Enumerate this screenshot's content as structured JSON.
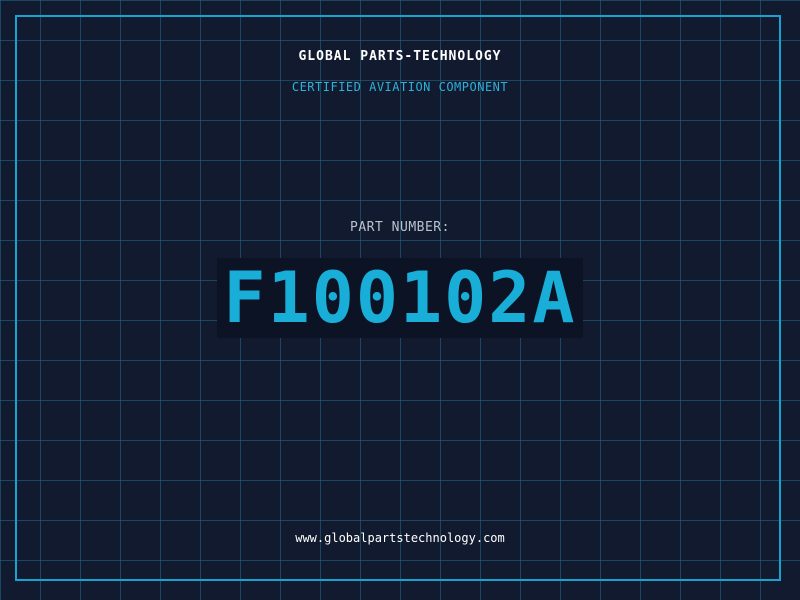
{
  "header": {
    "company": "GLOBAL PARTS-TECHNOLOGY",
    "tagline": "CERTIFIED AVIATION COMPONENT"
  },
  "part": {
    "label": "PART NUMBER:",
    "number": "F100102A"
  },
  "footer": {
    "website": "www.globalpartstechnology.com"
  },
  "colors": {
    "background": "#111a2e",
    "accent": "#19aed8",
    "grid": "#1e6e8c"
  }
}
